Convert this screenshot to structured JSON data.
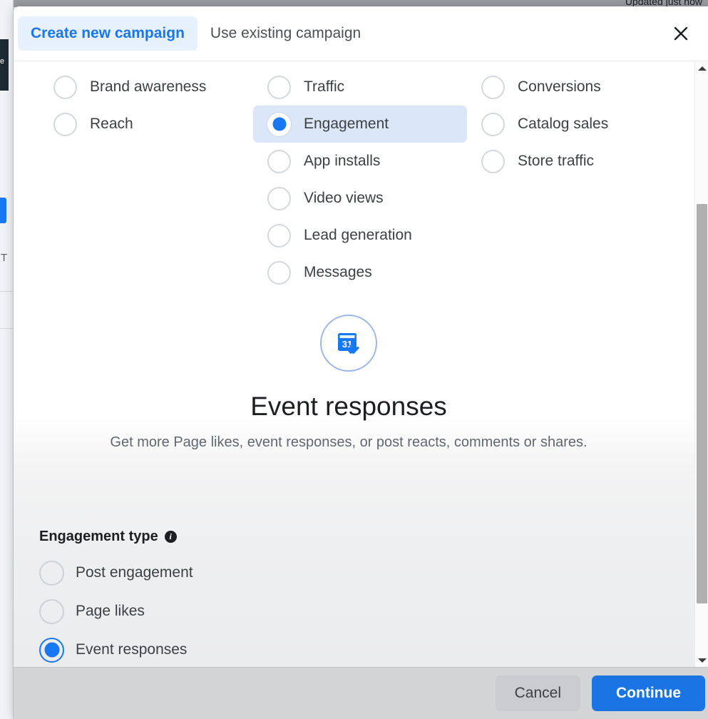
{
  "background": {
    "updated_text": "Updated just now",
    "rail_label": "e",
    "rail_letter": "T"
  },
  "modal": {
    "tabs": [
      {
        "label": "Create new campaign",
        "active": true
      },
      {
        "label": "Use existing campaign",
        "active": false
      }
    ],
    "close_icon": "close-icon",
    "objectives": {
      "columns": [
        {
          "name": "awareness",
          "options": [
            {
              "label": "Brand awareness",
              "selected": false
            },
            {
              "label": "Reach",
              "selected": false
            }
          ]
        },
        {
          "name": "consideration",
          "options": [
            {
              "label": "Traffic",
              "selected": false
            },
            {
              "label": "Engagement",
              "selected": true
            },
            {
              "label": "App installs",
              "selected": false
            },
            {
              "label": "Video views",
              "selected": false
            },
            {
              "label": "Lead generation",
              "selected": false
            },
            {
              "label": "Messages",
              "selected": false
            }
          ]
        },
        {
          "name": "conversion",
          "options": [
            {
              "label": "Conversions",
              "selected": false
            },
            {
              "label": "Catalog sales",
              "selected": false
            },
            {
              "label": "Store traffic",
              "selected": false
            }
          ]
        }
      ]
    },
    "hero": {
      "icon": "calendar-check-icon",
      "calendar_day": "31",
      "title": "Event responses",
      "description": "Get more Page likes, event responses, or post reacts, comments or shares."
    },
    "engagement_type": {
      "heading": "Engagement type",
      "info_icon": "info-icon",
      "info_glyph": "i",
      "options": [
        {
          "label": "Post engagement",
          "selected": false
        },
        {
          "label": "Page likes",
          "selected": false
        },
        {
          "label": "Event responses",
          "selected": true
        }
      ]
    },
    "footer": {
      "cancel_label": "Cancel",
      "continue_label": "Continue"
    },
    "scrollbar": {
      "up_icon": "scroll-up-arrow-icon",
      "down_icon": "scroll-down-arrow-icon"
    }
  },
  "colors": {
    "accent_blue": "#1877f2",
    "primary_button": "#1b74e4",
    "selected_row_bg": "#dbe7f8",
    "tab_active_bg": "#e7f0fd",
    "text_primary": "#1c1e21",
    "text_secondary": "#606770"
  }
}
